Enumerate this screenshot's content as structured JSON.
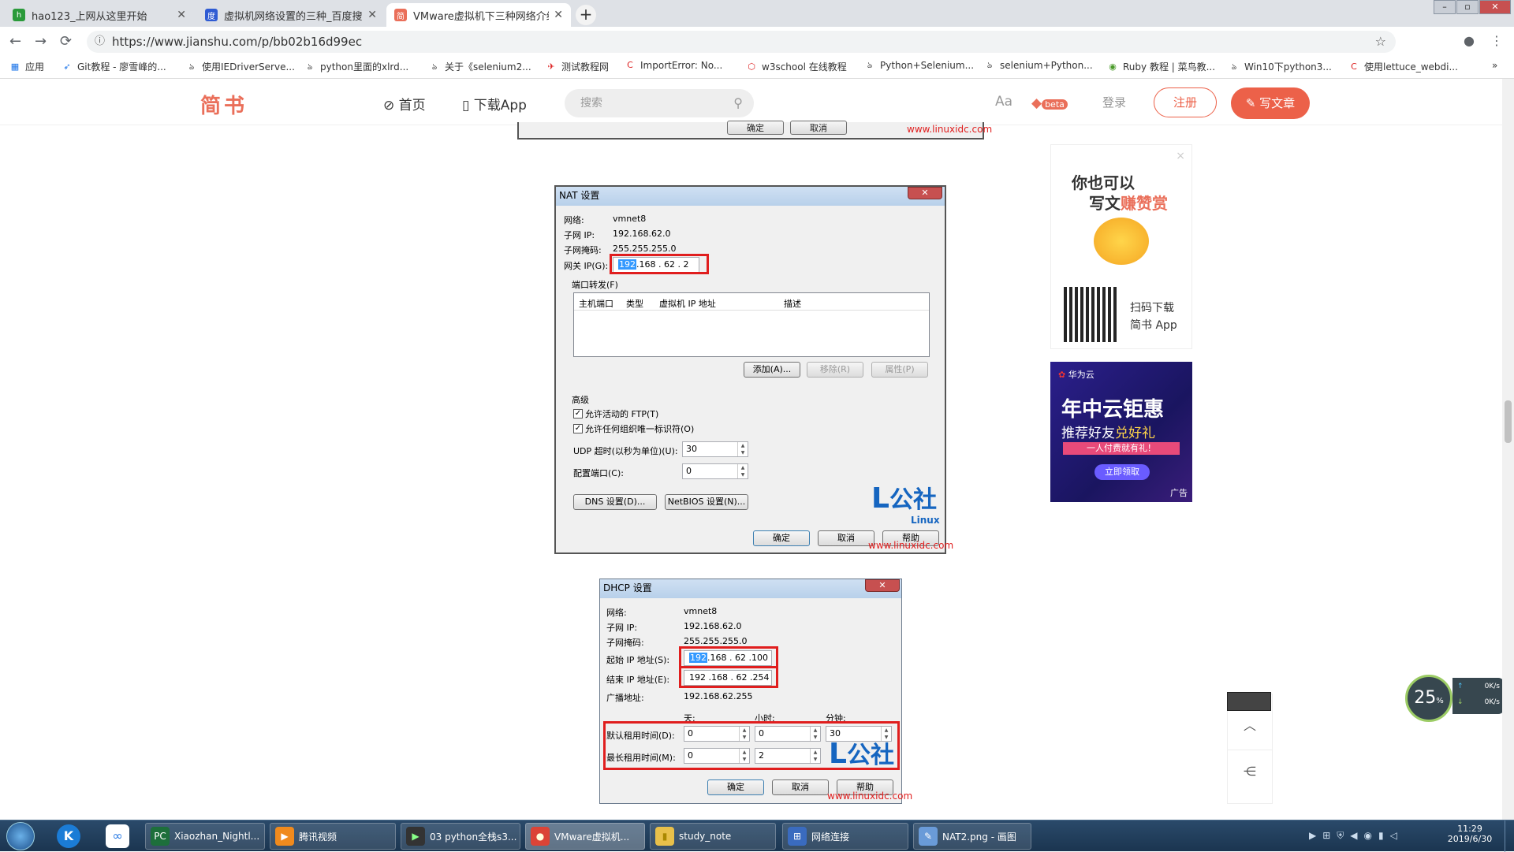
{
  "tabs": [
    {
      "title": "hao123_上网从这里开始",
      "color": "#2a9a3a",
      "glyph": "h"
    },
    {
      "title": "虚拟机网络设置的三种_百度搜索",
      "color": "#2f5bd3",
      "glyph": "度"
    },
    {
      "title": "VMware虚拟机下三种网络介绍...",
      "color": "#ea6f5a",
      "glyph": "简"
    }
  ],
  "window_buttons": [
    "–",
    "▫",
    "✕"
  ],
  "nav": {
    "back": "←",
    "forward": "→",
    "reload": "⟳",
    "url": "https://www.jianshu.com/p/bb02b16d99ec",
    "star": "☆",
    "profile": "●",
    "menu": "⋮"
  },
  "bookmarks": [
    "应用",
    "Git教程 - 廖雪峰的...",
    "使用IEDriverServe...",
    "python里面的xlrd...",
    "关于《selenium2...",
    "测试教程网",
    "ImportError: No...",
    "w3school 在线教程",
    "Python+Selenium...",
    "selenium+Python...",
    "Ruby 教程 | 菜鸟教...",
    "Win10下python3...",
    "使用lettuce_webdi..."
  ],
  "bookmarks_more": "»",
  "jianshu": {
    "logo": "简书",
    "home": "首页",
    "download": "下载App",
    "search_placeholder": "搜索",
    "aa": "Aa",
    "beta": "beta",
    "login": "登录",
    "register": "注册",
    "write": "写文章"
  },
  "nat": {
    "title": "NAT 设置",
    "network_label": "网络:",
    "network": "vmnet8",
    "subnet_label": "子网 IP:",
    "subnet": "192.168.62.0",
    "mask_label": "子网掩码:",
    "mask": "255.255.255.0",
    "gateway_label": "网关 IP(G):",
    "gateway_first": "192",
    "gateway_rest": ".168 . 62 . 2",
    "port_forward": "端口转发(F)",
    "cols": [
      "主机端口",
      "类型",
      "虚拟机 IP 地址",
      "描述"
    ],
    "add": "添加(A)...",
    "remove": "移除(R)",
    "props": "属性(P)",
    "advanced": "高级",
    "ftp": "允许活动的 FTP(T)",
    "oui": "允许任何组织唯一标识符(O)",
    "udp_label": "UDP 超时(以秒为单位)(U):",
    "udp": "30",
    "cfgport_label": "配置端口(C):",
    "cfgport": "0",
    "dns": "DNS 设置(D)...",
    "netbios": "NetBIOS 设置(N)...",
    "ok": "确定",
    "cancel": "取消",
    "help": "帮助"
  },
  "dhcp": {
    "title": "DHCP 设置",
    "network_label": "网络:",
    "network": "vmnet8",
    "subnet_label": "子网 IP:",
    "subnet": "192.168.62.0",
    "mask_label": "子网掩码:",
    "mask": "255.255.255.0",
    "start_label": "起始 IP 地址(S):",
    "start_first": "192",
    "start_rest": ".168 . 62 .100",
    "end_label": "结束 IP 地址(E):",
    "end": "192 .168 . 62 .254",
    "bcast_label": "广播地址:",
    "bcast": "192.168.62.255",
    "day": "天:",
    "hour": "小时:",
    "minute": "分钟:",
    "default_lease": "默认租用时间(D):",
    "default_day": "0",
    "default_hour": "0",
    "default_min": "30",
    "max_lease": "最长租用时间(M):",
    "max_day": "0",
    "max_hour": "2",
    "ok": "确定",
    "cancel": "取消",
    "help": "帮助"
  },
  "top_partial": {
    "b1": "确定",
    "b2": "取消"
  },
  "watermark": {
    "brand": "公社",
    "sub": "Linux",
    "url": "www.linuxidc.com"
  },
  "ad1": {
    "line1": "你也可以",
    "line2a": "写文",
    "line2b": "赚赞赏",
    "scan": "扫码下载",
    "app": "简书 App",
    "close": "×"
  },
  "ad2": {
    "brand": "华为云",
    "title": "年中云钜惠",
    "sub1": "推荐好友",
    "sub2": "兑好礼",
    "ribbon": "一人付费就有礼！",
    "cta": "立即领取",
    "tag": "广告"
  },
  "speed": {
    "percent": "25",
    "unit": "%",
    "up": "0K/s",
    "down": "0K/s"
  },
  "taskbar": {
    "items": [
      {
        "label": "Xiaozhan_Nightl...",
        "color": "#1d6f3b",
        "glyph": "PC"
      },
      {
        "label": "腾讯视频",
        "color": "#f08a1d",
        "glyph": "▶"
      },
      {
        "label": "03 python全栈s3...",
        "color": "#333",
        "glyph": "▶"
      },
      {
        "label": "VMware虚拟机...",
        "color": "#db4437",
        "glyph": "●"
      },
      {
        "label": "study_note",
        "color": "#e8c04a",
        "glyph": "▮"
      },
      {
        "label": "网络连接",
        "color": "#3a6bbf",
        "glyph": "⊞"
      },
      {
        "label": "NAT2.png - 画图",
        "color": "#6a9bd8",
        "glyph": "✎"
      }
    ],
    "time": "11:29",
    "date": "2019/6/30"
  },
  "colors": {
    "jianshu_red": "#ea6f5a",
    "highlight": "#e01e1e",
    "selection": "#3399ff"
  }
}
